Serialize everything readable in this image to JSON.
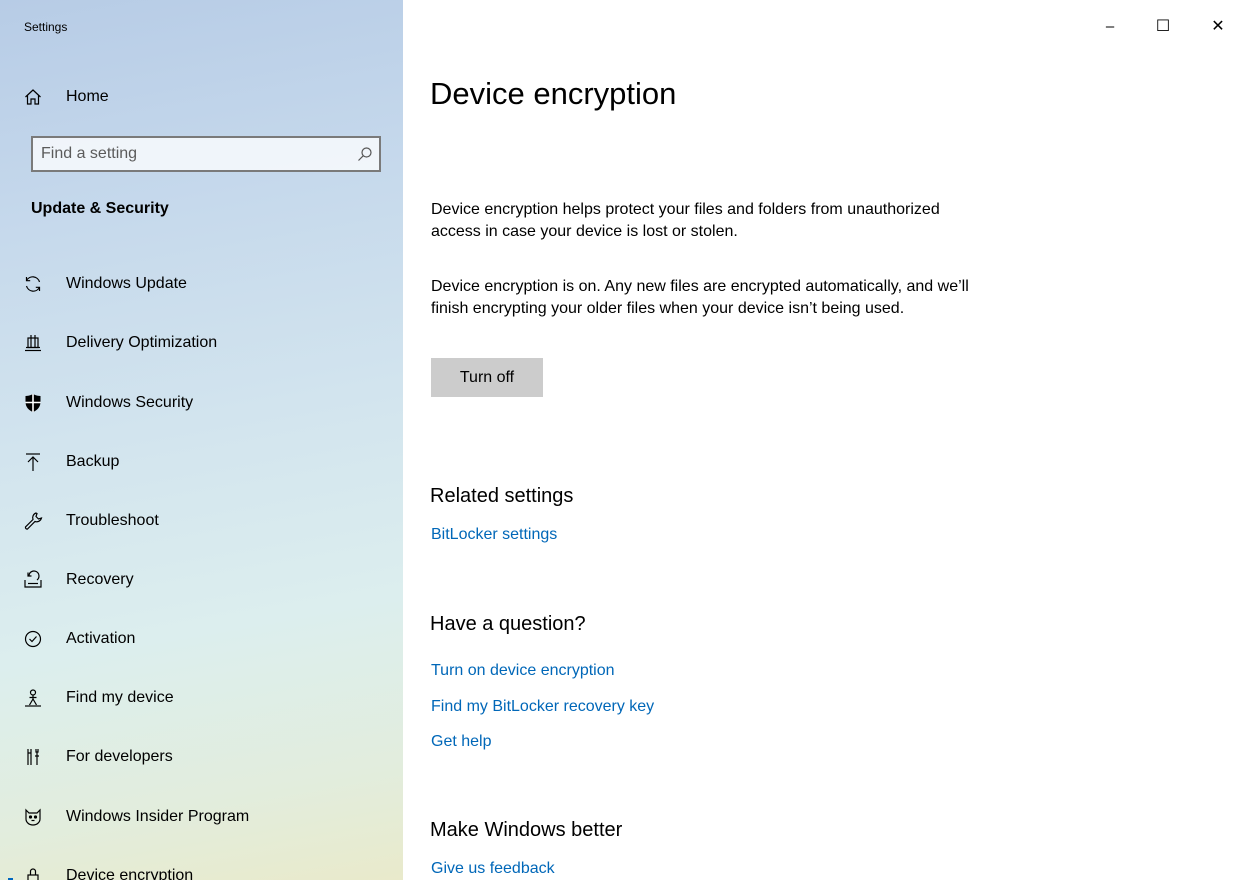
{
  "window": {
    "title": "Settings",
    "minimize_glyph": "–",
    "maximize_glyph": "☐",
    "close_glyph": "✕"
  },
  "sidebar": {
    "home": {
      "label": "Home",
      "icon": "home-icon"
    },
    "search": {
      "placeholder": "Find a setting",
      "value": "",
      "icon": "search-icon"
    },
    "section_heading": "Update & Security",
    "items": [
      {
        "label": "Windows Update",
        "icon": "refresh-icon"
      },
      {
        "label": "Delivery Optimization",
        "icon": "delivery-optimization-icon"
      },
      {
        "label": "Windows Security",
        "icon": "shield-icon"
      },
      {
        "label": "Backup",
        "icon": "upload-arrow-icon"
      },
      {
        "label": "Troubleshoot",
        "icon": "wrench-icon"
      },
      {
        "label": "Recovery",
        "icon": "recovery-icon"
      },
      {
        "label": "Activation",
        "icon": "check-circle-icon"
      },
      {
        "label": "Find my device",
        "icon": "person-pin-icon"
      },
      {
        "label": "For developers",
        "icon": "developer-tools-icon"
      },
      {
        "label": "Windows Insider Program",
        "icon": "insider-cat-icon"
      },
      {
        "label": "Device encryption",
        "icon": "lock-icon",
        "selected": true
      }
    ],
    "accent_color": "#0067c0"
  },
  "main": {
    "title": "Device encryption",
    "description": "Device encryption helps protect your files and folders from unauthorized access in case your device is lost or stolen.",
    "status": "Device encryption is on. Any new files are encrypted automatically, and we’ll finish encrypting your older files when your device isn’t being used.",
    "turn_off_button": "Turn off",
    "related_settings": {
      "heading": "Related settings",
      "links": [
        "BitLocker settings"
      ]
    },
    "have_a_question": {
      "heading": "Have a question?",
      "links": [
        "Turn on device encryption",
        "Find my BitLocker recovery key",
        "Get help"
      ]
    },
    "make_windows_better": {
      "heading": "Make Windows better",
      "links": [
        "Give us feedback"
      ]
    },
    "link_color": "#0067b8"
  }
}
